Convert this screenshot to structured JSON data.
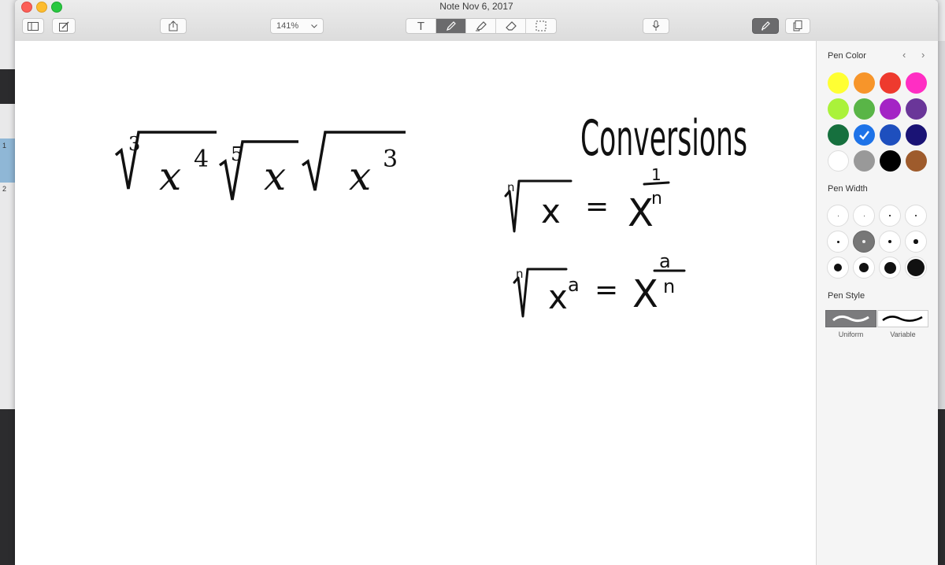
{
  "window": {
    "title": "Note Nov 6, 2017"
  },
  "toolbar": {
    "zoom_value": "141%",
    "sidebar_icon": "sidebar-icon",
    "compose_icon": "compose-icon",
    "share_icon": "share-icon",
    "text_tool": "T",
    "mic_icon": "microphone-icon",
    "active_color": "#6b6b6d"
  },
  "background_app": {
    "row_numbers": [
      "1",
      "2"
    ]
  },
  "note": {
    "typed_expression": {
      "first_root_index": "3",
      "first_exponent": "4",
      "second_root_index": "5",
      "third_exponent": "3",
      "variable": "x"
    },
    "handwriting": {
      "heading": "Conversions",
      "rule1": {
        "index": "n",
        "base": "x",
        "equals": "=",
        "result": "X",
        "num": "1",
        "den": "n"
      },
      "rule2": {
        "index": "n",
        "base": "x",
        "power": "a",
        "equals": "=",
        "result": "X",
        "num": "a",
        "den": "n"
      }
    }
  },
  "panel": {
    "pen_color_title": "Pen Color",
    "pen_width_title": "Pen Width",
    "pen_style_title": "Pen Style",
    "nav_prev": "‹",
    "nav_next": "›",
    "colors": [
      "#ffff33",
      "#f7952a",
      "#ee3a2e",
      "#ff2ec3",
      "#aaf23a",
      "#59b547",
      "#a424c5",
      "#6a3699",
      "#16703e",
      "#1e73e8",
      "#1e4fbe",
      "#1a1375",
      "#ffffff",
      "#999999",
      "#000000",
      "#9e5b2c"
    ],
    "selected_color_index": 9,
    "selected_width_index": 5,
    "styles": [
      "Uniform",
      "Variable"
    ],
    "selected_style_index": 0
  }
}
